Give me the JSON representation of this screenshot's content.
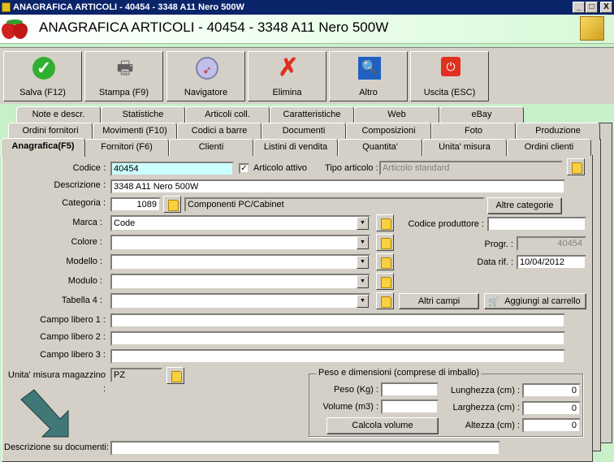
{
  "window": {
    "title": "ANAGRAFICA ARTICOLI - 40454 - 3348 A11 Nero 500W",
    "minimize": "_",
    "maximize": "□",
    "close": "X"
  },
  "header": {
    "title": "ANAGRAFICA ARTICOLI - 40454 - 3348 A11 Nero 500W"
  },
  "toolbar": [
    {
      "label": "Salva (F12)",
      "icon": "check-icon"
    },
    {
      "label": "Stampa (F9)",
      "icon": "printer-icon"
    },
    {
      "label": "Navigatore",
      "icon": "compass-icon"
    },
    {
      "label": "Elimina",
      "icon": "delete-x-icon"
    },
    {
      "label": "Altro",
      "icon": "book-search-icon"
    },
    {
      "label": "Uscita (ESC)",
      "icon": "power-icon"
    }
  ],
  "tabs_row1": [
    "Note e descr.",
    "Statistiche",
    "Articoli coll.",
    "Caratteristiche",
    "Web",
    "eBay"
  ],
  "tabs_row2": [
    "Ordini fornitori",
    "Movimenti (F10)",
    "Codici a barre",
    "Documenti",
    "Composizioni",
    "Foto",
    "Produzione"
  ],
  "tabs_row3": [
    "Anagrafica(F5)",
    "Fornitori (F6)",
    "Clienti",
    "Listini di vendita",
    "Quantita'",
    "Unita' misura",
    "Ordini clienti"
  ],
  "form": {
    "codice_label": "Codice :",
    "codice": "40454",
    "attivo_label": "Articolo attivo",
    "attivo_check": "✓",
    "tipo_label": "Tipo articolo :",
    "tipo": "Articolo standard",
    "descrizione_label": "Descrizione :",
    "descrizione": "3348 A11 Nero 500W",
    "categoria_label": "Categoria :",
    "categoria_code": "1089",
    "categoria_name": "Componenti PC/Cabinet",
    "altre_categorie": "Altre categorie",
    "marca_label": "Marca :",
    "marca": "Code",
    "colore_label": "Colore :",
    "modello_label": "Modello :",
    "modulo_label": "Modulo :",
    "tabella4_label": "Tabella 4 :",
    "codice_produttore_label": "Codice produttore :",
    "codice_produttore": "",
    "progr_label": "Progr. :",
    "progr": "40454",
    "data_label": "Data rif. :",
    "data": "10/04/2012",
    "altri_campi": "Altri campi",
    "aggiungi_carrello": "Aggiungi al carrello",
    "campo1_label": "Campo libero 1 :",
    "campo2_label": "Campo libero 2 :",
    "campo3_label": "Campo libero 3 :",
    "unita_label": "Unita' misura magazzino :",
    "unita": "PZ",
    "peso_group": "Peso e dimensioni (comprese di imballo)",
    "peso_label": "Peso (Kg) :",
    "volume_label": "Volume (m3) :",
    "calcola": "Calcola volume",
    "lunghezza_label": "Lunghezza (cm) :",
    "lunghezza": "0",
    "larghezza_label": "Larghezza (cm) :",
    "larghezza": "0",
    "altezza_label": "Altezza (cm) :",
    "altezza": "0",
    "desc_doc_label": "Descrizione su documenti:"
  }
}
